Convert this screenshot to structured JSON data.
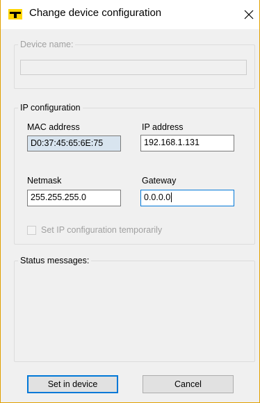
{
  "window": {
    "title": "Change device configuration",
    "close_glyph": "✕",
    "icons": {
      "app": "app-logo-icon",
      "close": "close-icon"
    },
    "colors": {
      "accent": "#0078d7",
      "brand": "#ffd600",
      "border": "#e1a000"
    }
  },
  "device_group": {
    "legend": "Device name:",
    "name_value": ""
  },
  "ip_group": {
    "legend": "IP configuration",
    "mac_label": "MAC address",
    "mac_value": "D0:37:45:65:6E:75",
    "ip_label": "IP address",
    "ip_value": "192.168.1.131",
    "netmask_label": "Netmask",
    "netmask_value": "255.255.255.0",
    "gateway_label": "Gateway",
    "gateway_value": "0.0.0.0",
    "temp_checkbox_label": "Set IP configuration temporarily",
    "temp_checked": false
  },
  "status_group": {
    "legend": "Status messages:"
  },
  "buttons": {
    "set_label": "Set in device",
    "cancel_label": "Cancel"
  }
}
